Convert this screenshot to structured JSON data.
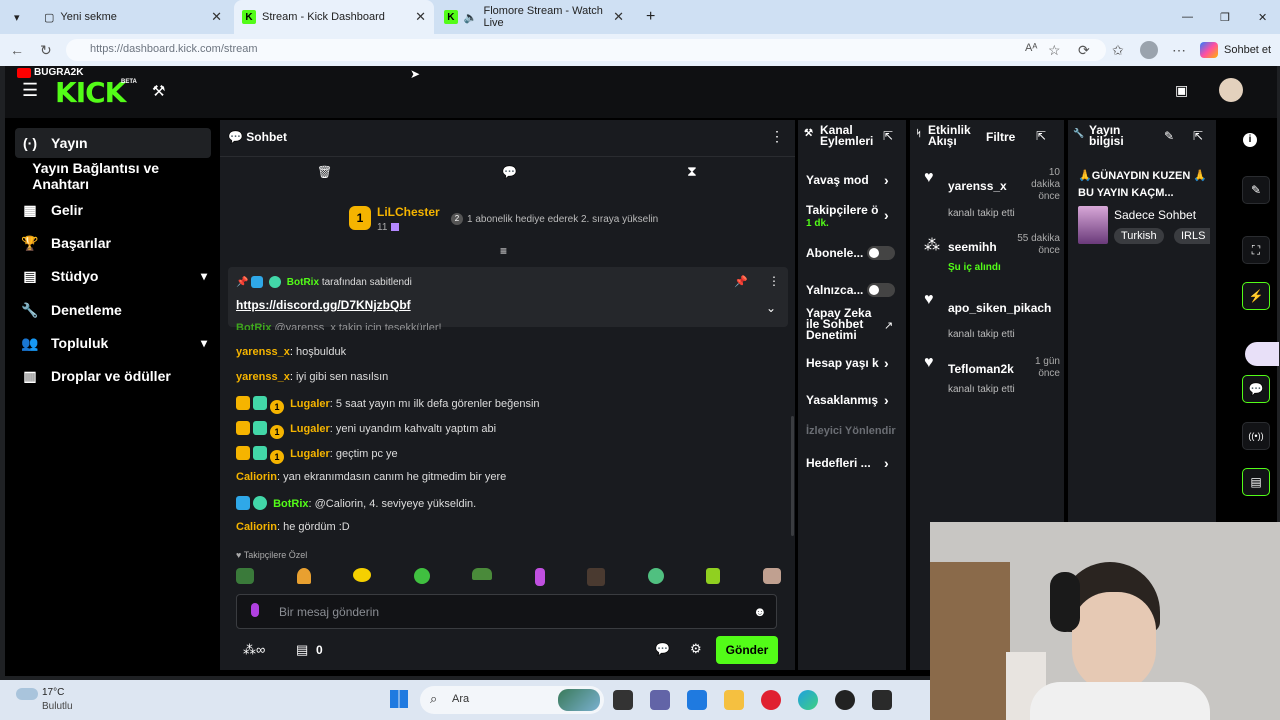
{
  "browser": {
    "tabs": [
      {
        "title": "Yeni sekme"
      },
      {
        "title": "Stream - Kick Dashboard"
      },
      {
        "title": "Flomore Stream - Watch Live"
      }
    ],
    "url": "https://dashboard.kick.com/stream",
    "copilot_label": "Sohbet et"
  },
  "header": {
    "channel_tag": "BUGRA2K",
    "logo": "KICK",
    "logo_badge": "BETA"
  },
  "sidebar": {
    "items": [
      {
        "label": "Yayın",
        "icon": "broadcast-icon"
      },
      {
        "label": "Yayın Bağlantısı ve Anahtarı",
        "icon": ""
      },
      {
        "label": "Gelir",
        "icon": "revenue-icon"
      },
      {
        "label": "Başarılar",
        "icon": "trophy-icon"
      },
      {
        "label": "Stüdyo",
        "icon": "studio-icon"
      },
      {
        "label": "Denetleme",
        "icon": "wrench-icon"
      },
      {
        "label": "Topluluk",
        "icon": "community-icon"
      },
      {
        "label": "Droplar ve ödüller",
        "icon": "gift-icon"
      }
    ]
  },
  "chat": {
    "title": "Sohbet",
    "gift_event": {
      "user": "LiLChester",
      "count": "11",
      "text": "1 abonelik hediye ederek 2. sıraya yükselin",
      "gift_num": "2"
    },
    "pinned": {
      "by_user": "BotRix",
      "by_text": "tarafından sabitlendi",
      "link": "https://discord.gg/D7KNjzbQbf"
    },
    "partial_line": {
      "user": "BotRix",
      "text": "@yarenss_x takip için teşekkürler!"
    },
    "messages": [
      {
        "user": "yarenss_x",
        "text": "hoşbulduk",
        "color": "#f5b400",
        "badges": []
      },
      {
        "user": "yarenss_x",
        "text": "iyi gibi sen nasılsın",
        "color": "#f5b400",
        "badges": []
      },
      {
        "user": "Lugaler",
        "text": "5 saat yayın mı ilk defa görenler beğensin",
        "color": "#f5b400",
        "badges": [
          "crown",
          "gift",
          "one"
        ]
      },
      {
        "user": "Lugaler",
        "text": "yeni uyandım kahvaltı yaptım abi",
        "color": "#f5b400",
        "badges": [
          "crown",
          "gift",
          "one"
        ]
      },
      {
        "user": "Lugaler",
        "text": "geçtim pc ye",
        "color": "#f5b400",
        "badges": [
          "crown",
          "gift",
          "one"
        ]
      },
      {
        "user": "Caliorin",
        "text": "yan ekranımdasın canım he gitmedim bir yere",
        "color": "#f5b400",
        "badges": []
      },
      {
        "user": "BotRix",
        "text": "@Caliorin, 4. seviyeye yükseldin.",
        "color": "#53fc18",
        "badges": [
          "bot",
          "verified"
        ]
      },
      {
        "user": "Caliorin",
        "text": "he gördüm :D",
        "color": "#f5b400",
        "badges": []
      }
    ],
    "emote_section": "Takipçilere Özel",
    "input_placeholder": "Bir mesaj gönderin",
    "points": "0",
    "send_label": "Gönder"
  },
  "channel_actions": {
    "title": "Kanal Eylemleri",
    "items": [
      {
        "label": "Yavaş mod",
        "sub": ""
      },
      {
        "label": "Takipçilere ö",
        "sub": "1 dk."
      },
      {
        "label": "Abonele...",
        "sub": ""
      },
      {
        "label": "Yalnızca...",
        "sub": ""
      },
      {
        "label": "Yapay Zeka ile Sohbet Denetimi",
        "sub": ""
      },
      {
        "label": "Hesap yaşı k",
        "sub": ""
      },
      {
        "label": "Yasaklanmış",
        "sub": ""
      },
      {
        "label": "İzleyici Yönlendir",
        "sub": ""
      },
      {
        "label": "Hedefleri ...",
        "sub": ""
      }
    ]
  },
  "activity": {
    "title": "Etkinlik Akışı",
    "filter": "Filtre",
    "events": [
      {
        "user": "yarenss_x",
        "action": "kanalı takip etti",
        "time": "10 dakika önce"
      },
      {
        "user": "seemihh",
        "action": "Şu iç alındı",
        "time": "55 dakika önce"
      },
      {
        "user": "apo_siken_pikach",
        "action": "kanalı takip etti",
        "time": ""
      },
      {
        "user": "Tefloman2k",
        "action": "kanalı takip etti",
        "time": "1 gün önce"
      }
    ]
  },
  "stream_info": {
    "title": "Yayın bilgisi",
    "stream_title": "🙏GÜNAYDIN KUZEN 🙏BU YAYIN KAÇM...",
    "category": "Sadece Sohbet",
    "tags": [
      "Turkish",
      "IRLS"
    ]
  },
  "taskbar": {
    "temp": "17°C",
    "weather": "Bulutlu",
    "search": "Ara"
  }
}
